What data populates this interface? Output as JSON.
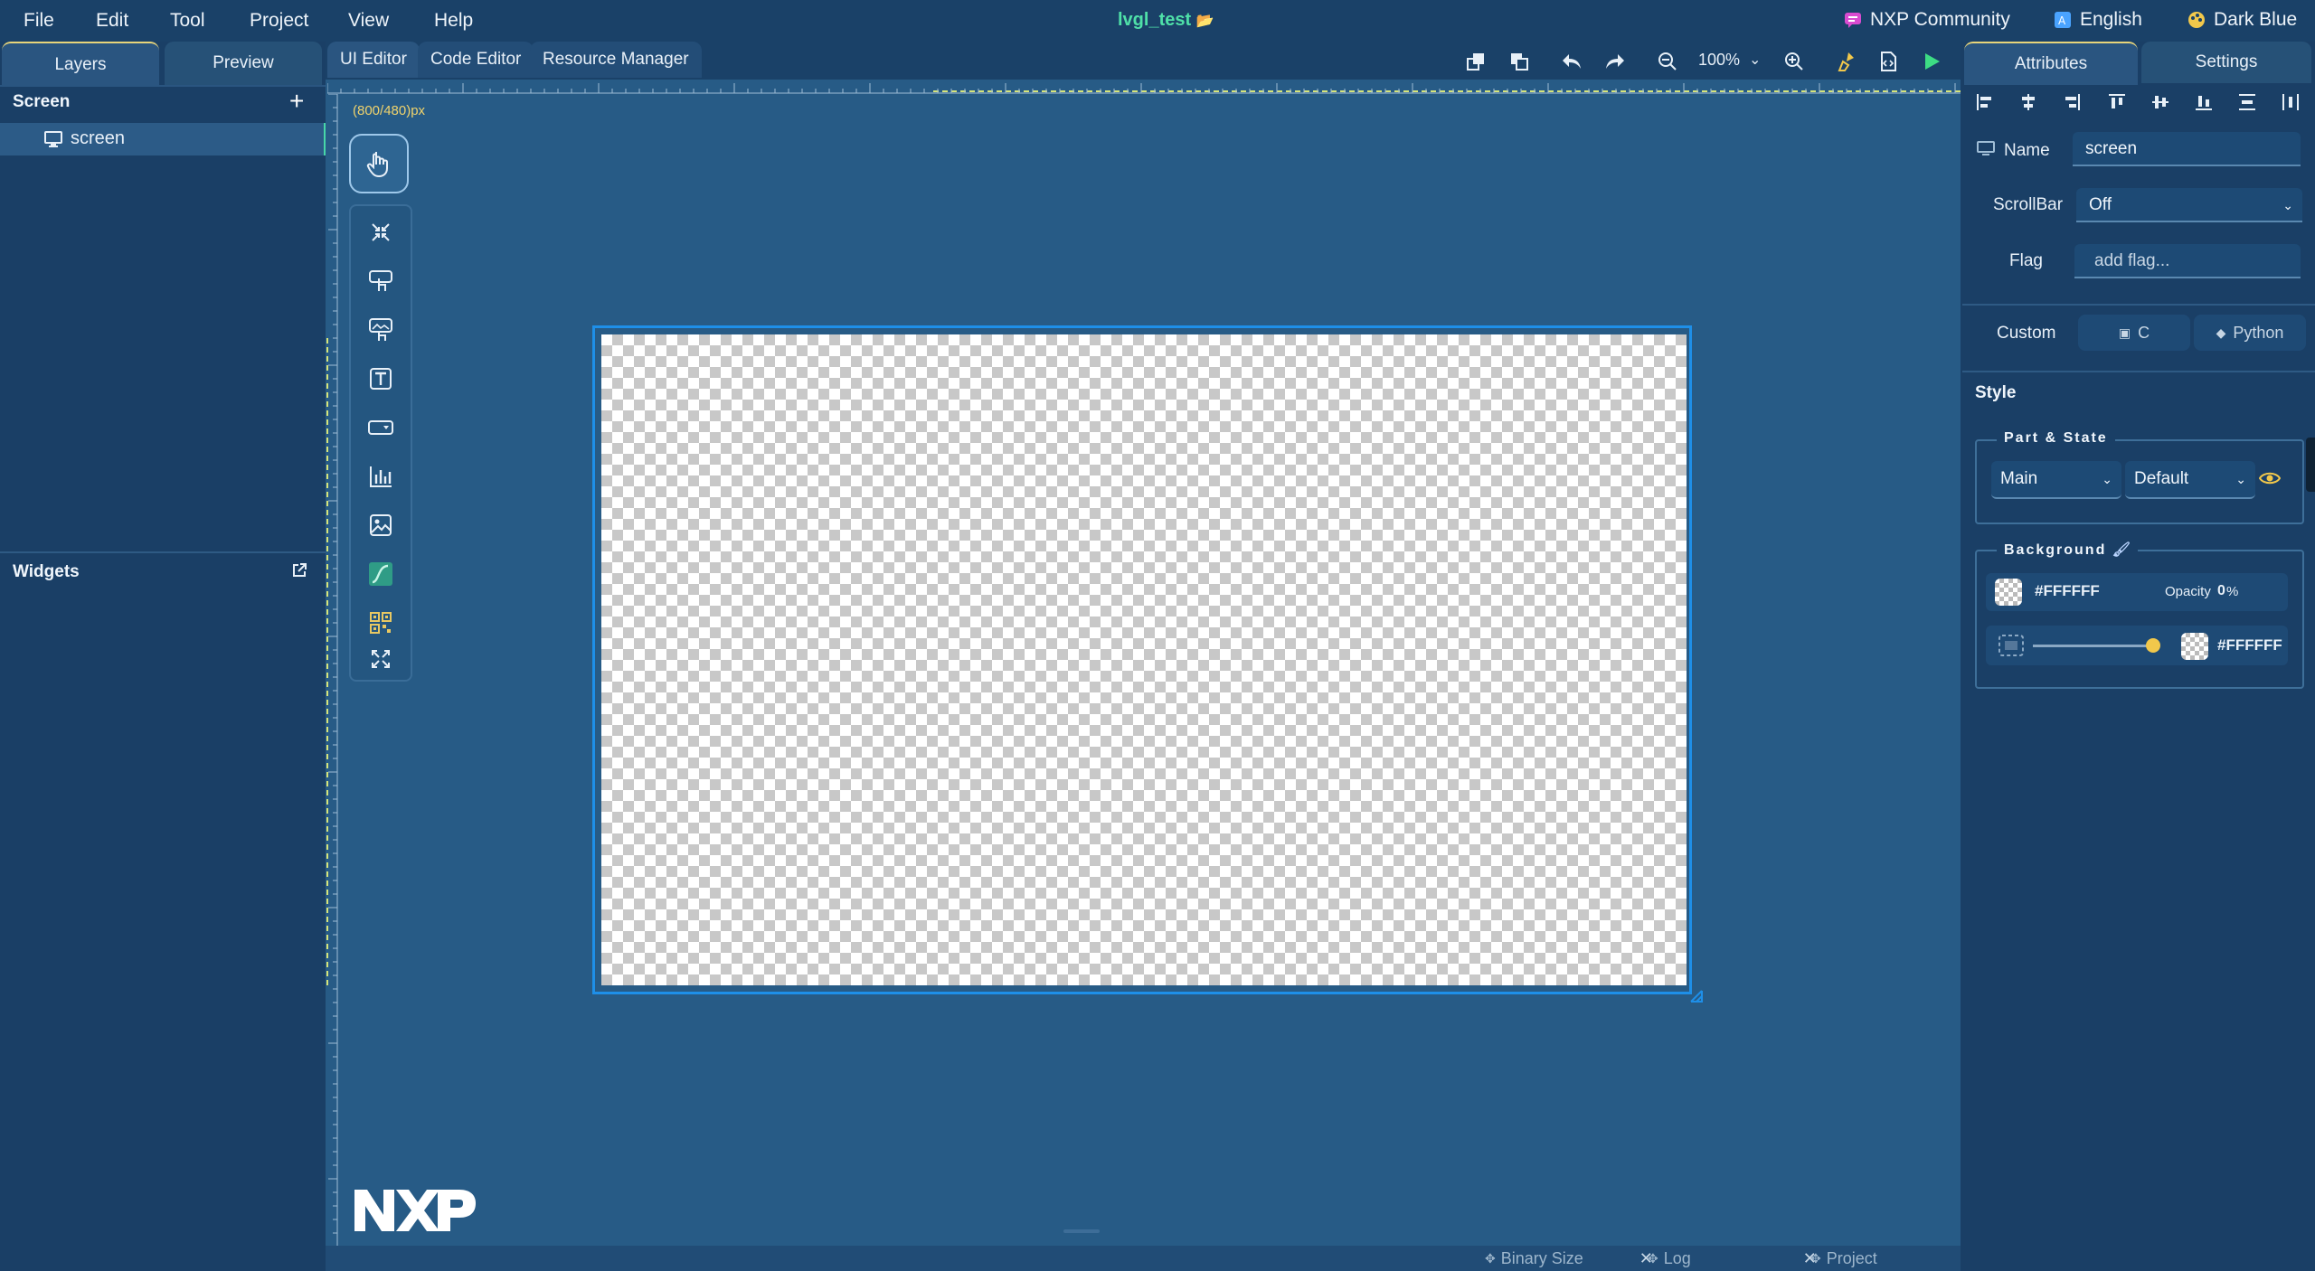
{
  "menu": [
    "File",
    "Edit",
    "Tool",
    "Project",
    "View",
    "Help"
  ],
  "project_title": "lvgl_test",
  "top_right": {
    "community": "NXP Community",
    "language": "English",
    "theme": "Dark Blue"
  },
  "left_tabs": [
    "Layers",
    "Preview"
  ],
  "layers": {
    "section_title": "Screen",
    "screen_item": "screen"
  },
  "widgets_title": "Widgets",
  "editor_tabs": [
    "UI Editor",
    "Code Editor",
    "Resource Manager"
  ],
  "zoom": "100%",
  "canvas": {
    "dimension_label": "(800/480)px"
  },
  "palette_icons": [
    "pointer-icon",
    "collapse-icon",
    "button-icon",
    "image-button-icon",
    "label-icon",
    "dropdown-icon",
    "chart-icon",
    "image-icon",
    "line-icon",
    "qr-code-icon",
    "expand-icon"
  ],
  "logo": "NXP",
  "bottom_tabs": [
    "Binary Size",
    "Log",
    "Project"
  ],
  "right_tabs": [
    "Attributes",
    "Settings"
  ],
  "attributes": {
    "name_label": "Name",
    "name_value": "screen",
    "scrollbar_label": "ScrollBar",
    "scrollbar_value": "Off",
    "flag_label": "Flag",
    "flag_placeholder": "add flag...",
    "custom_label": "Custom",
    "custom_c": "C",
    "custom_python": "Python"
  },
  "style": {
    "title": "Style",
    "part_state_legend": "Part & State",
    "part_value": "Main",
    "state_value": "Default",
    "background_legend": "Background",
    "bg_color": "#FFFFFF",
    "opacity_label": "Opacity",
    "opacity_value": "0",
    "opacity_unit": "%",
    "gradient_color": "#FFFFFF",
    "slider_fraction": 0.95
  },
  "colors": {
    "accent_green": "#4fe0a8",
    "selection_blue": "#1e8fe8",
    "run_green": "#3ddc84"
  }
}
